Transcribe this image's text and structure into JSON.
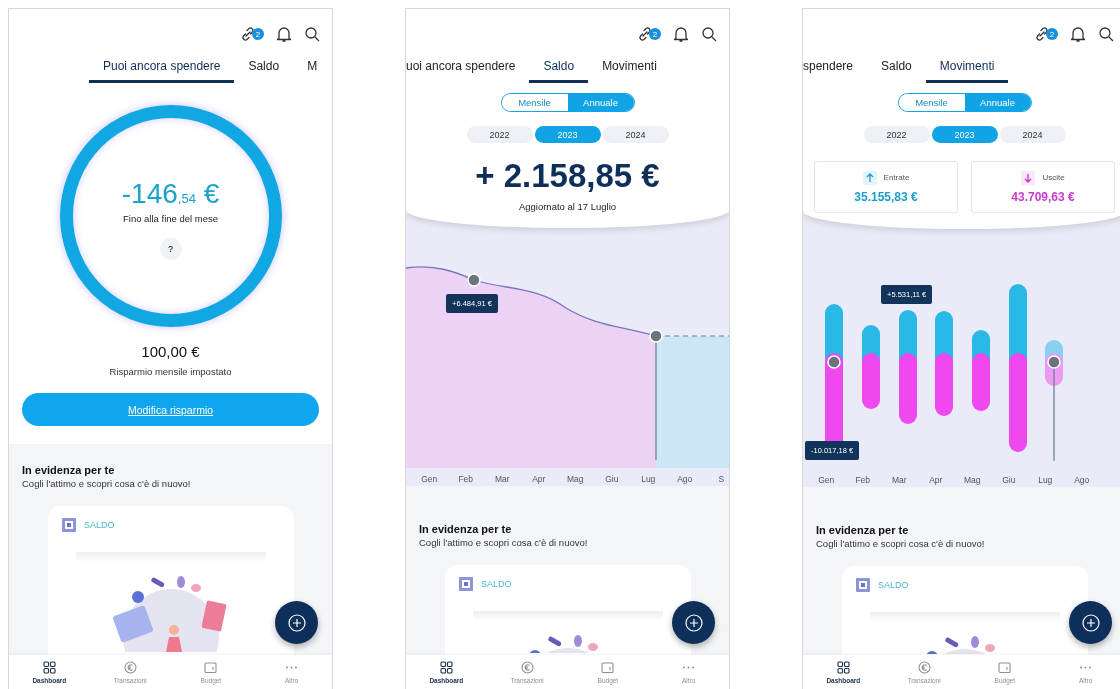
{
  "phones": [
    {
      "kind": "spend",
      "badge": "2",
      "tabs": [
        {
          "label": "Puoi ancora spendere",
          "selected": true
        },
        {
          "label": "Saldo",
          "selected": false
        },
        {
          "label": "M",
          "selected": false
        }
      ],
      "remaining": {
        "amount": "-146",
        "cents": ",54",
        "currency": "€",
        "caption": "Fino alla fine del mese",
        "help": "?"
      },
      "saving": {
        "amount": "100,00 €",
        "caption": "Risparmio mensile impostato",
        "button": "Modifica risparmio"
      },
      "featured": {
        "title": "In evidenza per te",
        "subtitle": "Cogli l'attimo e scopri cosa c'è di nuovo!",
        "card_label": "SALDO"
      },
      "nav": [
        {
          "label": "Dashboard",
          "kind": "grid",
          "selected": true
        },
        {
          "label": "Transazioni",
          "kind": "coin",
          "selected": false
        },
        {
          "label": "Budget",
          "kind": "wallet",
          "selected": false
        },
        {
          "label": "Altro",
          "kind": "more",
          "selected": false
        }
      ]
    },
    {
      "kind": "balance",
      "badge": "2",
      "tabs": [
        {
          "label": "uoi ancora spendere",
          "selected": false
        },
        {
          "label": "Saldo",
          "selected": true
        },
        {
          "label": "Movimenti",
          "selected": false
        }
      ],
      "periods": [
        {
          "label": "Mensile",
          "selected": false
        },
        {
          "label": "Annuale",
          "selected": true
        }
      ],
      "years": [
        {
          "label": "2022",
          "selected": false
        },
        {
          "label": "2023",
          "selected": true
        },
        {
          "label": "2024",
          "selected": false
        }
      ],
      "balance": {
        "amount": "+ 2.158,85 €",
        "updated": "Aggiornato al 17 Luglio"
      },
      "chart": {
        "kind": "area",
        "tooltips": [
          "+6.484,91 €"
        ],
        "months": [
          "Gen",
          "Feb",
          "Mar",
          "Apr",
          "Mag",
          "Giu",
          "Lug",
          "Ago",
          "S"
        ]
      },
      "featured": {
        "title": "In evidenza per te",
        "subtitle": "Cogli l'attimo e scopri cosa c'è di nuovo!",
        "card_label": "SALDO"
      },
      "nav": [
        {
          "label": "Dashboard",
          "kind": "grid",
          "selected": true
        },
        {
          "label": "Transazioni",
          "kind": "coin",
          "selected": false
        },
        {
          "label": "Budget",
          "kind": "wallet",
          "selected": false
        },
        {
          "label": "Altro",
          "kind": "more",
          "selected": false
        }
      ]
    },
    {
      "kind": "movements",
      "badge": "2",
      "tabs": [
        {
          "label": "spendere",
          "selected": false
        },
        {
          "label": "Saldo",
          "selected": false
        },
        {
          "label": "Movimenti",
          "selected": true
        }
      ],
      "periods": [
        {
          "label": "Mensile",
          "selected": false
        },
        {
          "label": "Annuale",
          "selected": true
        }
      ],
      "years": [
        {
          "label": "2022",
          "selected": false
        },
        {
          "label": "2023",
          "selected": true
        },
        {
          "label": "2024",
          "selected": false
        }
      ],
      "totals": [
        {
          "kind": "in",
          "label": "Entrate",
          "amount": "35.155,83 €"
        },
        {
          "kind": "out",
          "label": "Uscite",
          "amount": "43.709,63 €"
        }
      ],
      "chart": {
        "kind": "bars",
        "tooltips": [
          "+5.531,11 €",
          "-10.017,18 €"
        ],
        "months": [
          "Gen",
          "Feb",
          "Mar",
          "Apr",
          "Mag",
          "Giu",
          "Lug",
          "Ago"
        ]
      },
      "featured": {
        "title": "In evidenza per te",
        "subtitle": "Cogli l'attimo e scopri cosa c'è di nuovo!",
        "card_label": "SALDO"
      },
      "nav": [
        {
          "label": "Dashboard",
          "kind": "grid",
          "selected": true
        },
        {
          "label": "Transazioni",
          "kind": "coin",
          "selected": false
        },
        {
          "label": "Budget",
          "kind": "wallet",
          "selected": false
        },
        {
          "label": "Altro",
          "kind": "more",
          "selected": false
        }
      ]
    }
  ]
}
